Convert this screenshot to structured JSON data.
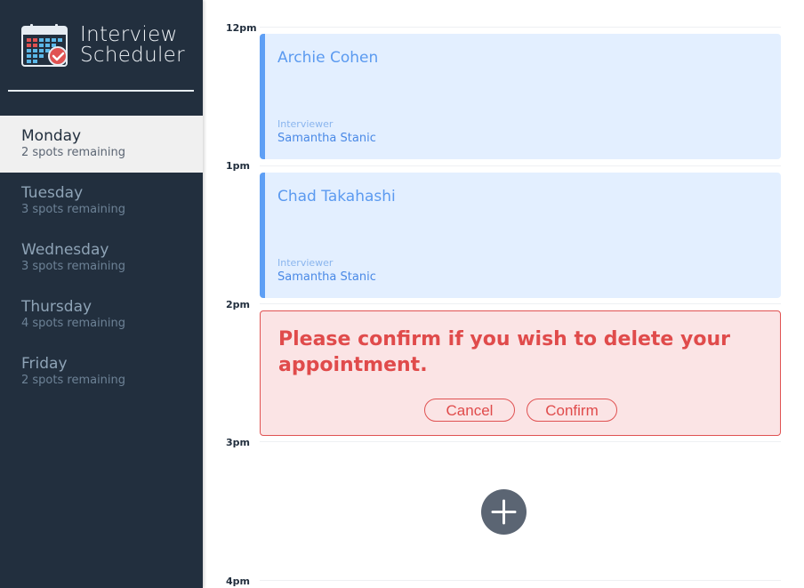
{
  "app": {
    "title_line1": "Interview",
    "title_line2": "Scheduler"
  },
  "colors": {
    "sidebar_bg": "#222f3e",
    "appointment_bg": "#e3efff",
    "appointment_accent": "#5e9ff5",
    "confirm_bg": "#fbe4e5",
    "confirm_accent": "#e05252",
    "add_button": "#5b6573"
  },
  "days": [
    {
      "name": "Monday",
      "spots": "2 spots remaining",
      "selected": true
    },
    {
      "name": "Tuesday",
      "spots": "3 spots remaining",
      "selected": false
    },
    {
      "name": "Wednesday",
      "spots": "3 spots remaining",
      "selected": false
    },
    {
      "name": "Thursday",
      "spots": "4 spots remaining",
      "selected": false
    },
    {
      "name": "Friday",
      "spots": "2 spots remaining",
      "selected": false
    }
  ],
  "times": [
    "12pm",
    "1pm",
    "2pm",
    "3pm",
    "4pm"
  ],
  "appointments": [
    {
      "student": "Archie Cohen",
      "interviewer_label": "Interviewer",
      "interviewer": "Samantha Stanic"
    },
    {
      "student": "Chad Takahashi",
      "interviewer_label": "Interviewer",
      "interviewer": "Samantha Stanic"
    }
  ],
  "confirm": {
    "message": "Please confirm if you wish to delete your appointment.",
    "cancel_label": "Cancel",
    "confirm_label": "Confirm"
  },
  "icons": {
    "logo": "calendar-check-icon",
    "add": "plus-icon"
  }
}
